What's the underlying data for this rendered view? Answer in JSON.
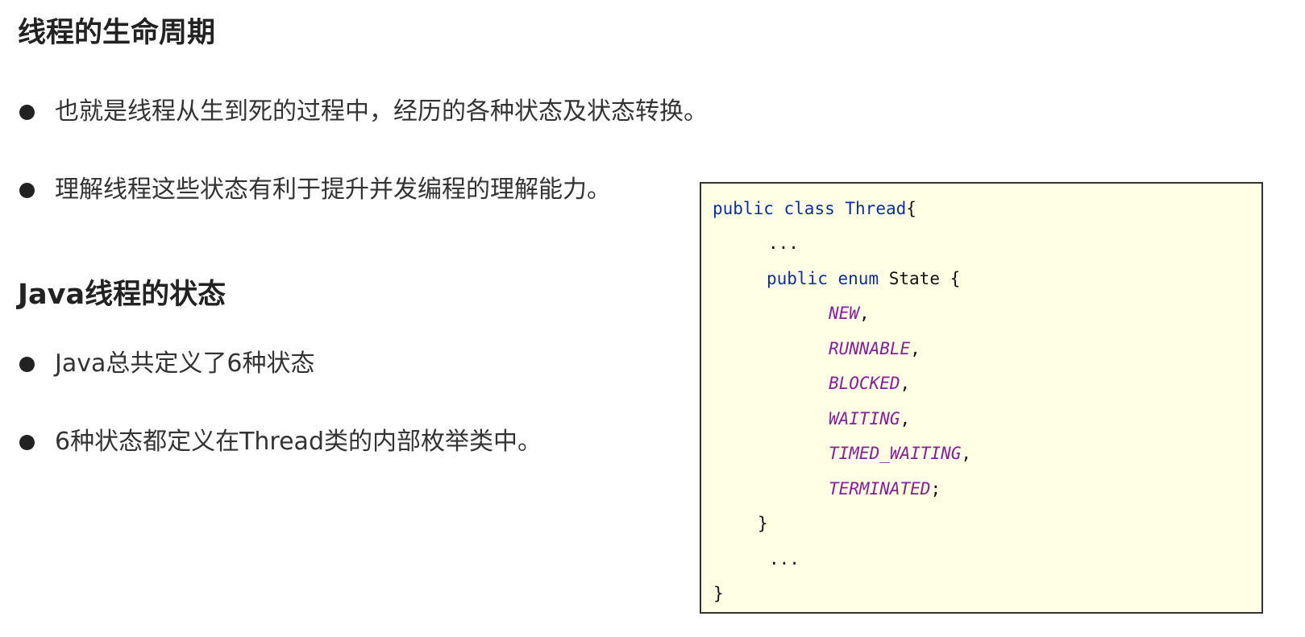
{
  "section1": {
    "title": "线程的生命周期",
    "bullets": [
      "也就是线程从生到死的过程中，经历的各种状态及状态转换。",
      "理解线程这些状态有利于提升并发编程的理解能力。"
    ]
  },
  "section2": {
    "title": "Java线程的状态",
    "bullets": [
      "Java总共定义了6种状态",
      "6种状态都定义在Thread类的内部枚举类中。"
    ]
  },
  "code": {
    "line1": {
      "kw1": "public",
      "kw2": "class",
      "kw3": "Thread",
      "punct": "{"
    },
    "ellipsis_top": "...",
    "line3": {
      "kw1": "public",
      "kw2": "enum",
      "name": "State",
      "punct": "{"
    },
    "constants": [
      {
        "name": "NEW",
        "punct": ","
      },
      {
        "name": "RUNNABLE",
        "punct": ","
      },
      {
        "name": "BLOCKED",
        "punct": ","
      },
      {
        "name": "WAITING",
        "punct": ","
      },
      {
        "name": "TIMED_WAITING",
        "punct": ","
      },
      {
        "name": "TERMINATED",
        "punct": ";"
      }
    ],
    "enum_close": "}",
    "ellipsis_bottom": "...",
    "class_close": "}"
  },
  "colors": {
    "keyword": "#0a2ea8",
    "enum_constant": "#8a1e9e",
    "code_background": "#ffffe4",
    "text": "#222222"
  }
}
